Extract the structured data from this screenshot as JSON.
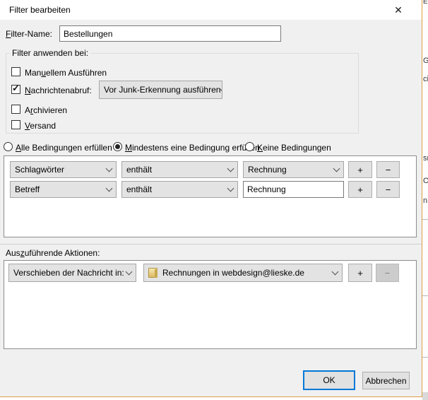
{
  "dialog": {
    "title": "Filter bearbeiten"
  },
  "glyphs": {
    "close": "✕",
    "check": "✓",
    "plus": "+",
    "minus": "−"
  },
  "filter_name": {
    "label": {
      "pre": "",
      "key": "F",
      "post": "ilter-Name:"
    },
    "value": "Bestellungen"
  },
  "apply_group": {
    "legend": "Filter anwenden bei:",
    "checkboxes": [
      {
        "pre": "Man",
        "key": "u",
        "post": "ellem Ausführen",
        "checked": false
      },
      {
        "pre": "",
        "key": "N",
        "post": "achrichtenabruf:",
        "checked": true
      },
      {
        "pre": "A",
        "key": "r",
        "post": "chivieren",
        "checked": false
      },
      {
        "pre": "",
        "key": "V",
        "post": "ersand",
        "checked": false
      }
    ],
    "fetch_dropdown": "Vor Junk-Erkennung ausführen"
  },
  "match_radios": [
    {
      "pre": "",
      "key": "A",
      "post": "lle Bedingungen erfüllen",
      "selected": false
    },
    {
      "pre": "",
      "key": "M",
      "post": "indestens eine Bedingung erfüllen",
      "selected": true
    },
    {
      "pre": "",
      "key": "K",
      "post": "eine Bedingungen",
      "selected": false
    }
  ],
  "conditions": {
    "rows": [
      {
        "field": "Schlagwörter",
        "op": "enthält",
        "value": "Rechnung"
      },
      {
        "field": "Betreff",
        "op": "enthält",
        "value": "Rechnung"
      }
    ]
  },
  "actions": {
    "label": {
      "pre": "Aus",
      "key": "z",
      "post": "uführende Aktionen:"
    },
    "rows": [
      {
        "action": "Verschieben der Nachricht in:",
        "target": "Rechnungen in webdesign@lieske.de"
      }
    ]
  },
  "buttons": {
    "ok": "OK",
    "cancel": "Abbrechen"
  },
  "background_window": {
    "fragments": [
      "Er",
      "G",
      "ci",
      "sr",
      "O",
      "n"
    ]
  },
  "colors": {
    "accent_blue": "#0078d7",
    "window_border": "#dd9f45",
    "folder": "#ddbb62",
    "dialog_bg": "#f0f0f0"
  }
}
